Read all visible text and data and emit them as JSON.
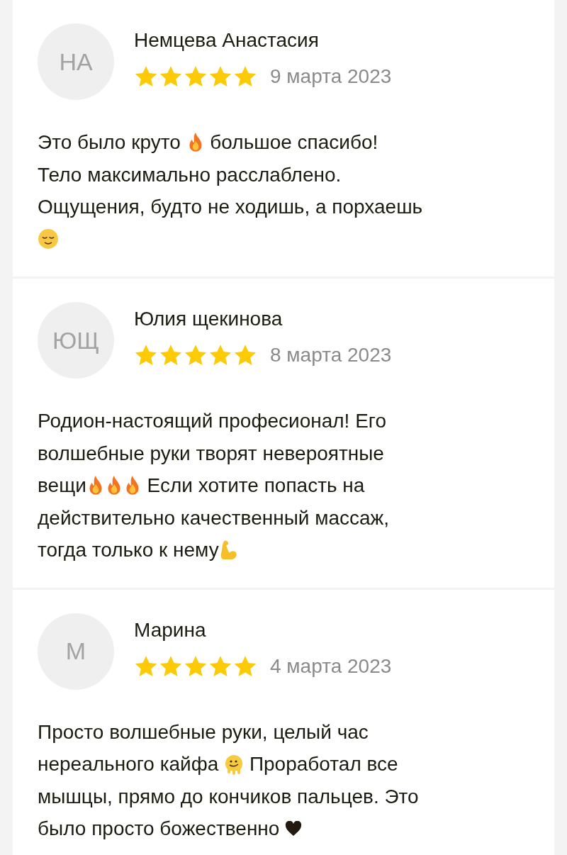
{
  "reviews": [
    {
      "initials": "НА",
      "name": "Немцева Анастасия",
      "stars": 5,
      "date": "9 марта 2023",
      "body": [
        [
          {
            "kind": "text",
            "text": "Это было круто "
          },
          {
            "kind": "fire"
          },
          {
            "kind": "text",
            "text": " большое спасибо!"
          }
        ],
        [
          {
            "kind": "text",
            "text": "Тело максимально расслаблено."
          }
        ],
        [
          {
            "kind": "text",
            "text": "Ощущения, будто не ходишь, а порхаешь"
          }
        ],
        [
          {
            "kind": "relieved"
          }
        ]
      ]
    },
    {
      "initials": "ЮЩ",
      "name": "Юлия щекинова",
      "stars": 5,
      "date": "8 марта 2023",
      "body": [
        [
          {
            "kind": "text",
            "text": "Родион-настоящий професионал! Его"
          }
        ],
        [
          {
            "kind": "text",
            "text": "волшебные руки творят невероятные"
          }
        ],
        [
          {
            "kind": "text",
            "text": "вещи"
          },
          {
            "kind": "fire"
          },
          {
            "kind": "fire"
          },
          {
            "kind": "fire"
          },
          {
            "kind": "text",
            "text": " Если хотите попасть на"
          }
        ],
        [
          {
            "kind": "text",
            "text": "действительно качественный массаж,"
          }
        ],
        [
          {
            "kind": "text",
            "text": "тогда только к нему"
          },
          {
            "kind": "muscle"
          }
        ]
      ]
    },
    {
      "initials": "М",
      "name": "Марина",
      "stars": 5,
      "date": "4 марта 2023",
      "body": [
        [
          {
            "kind": "text",
            "text": "Просто волшебные руки, целый час"
          }
        ],
        [
          {
            "kind": "text",
            "text": "нереального кайфа "
          },
          {
            "kind": "melting"
          },
          {
            "kind": "text",
            "text": " Проработал все"
          }
        ],
        [
          {
            "kind": "text",
            "text": "мышцы, прямо до кончиков пальцев. Это"
          }
        ],
        [
          {
            "kind": "text",
            "text": "было просто божественно "
          },
          {
            "kind": "heart"
          }
        ]
      ]
    }
  ]
}
